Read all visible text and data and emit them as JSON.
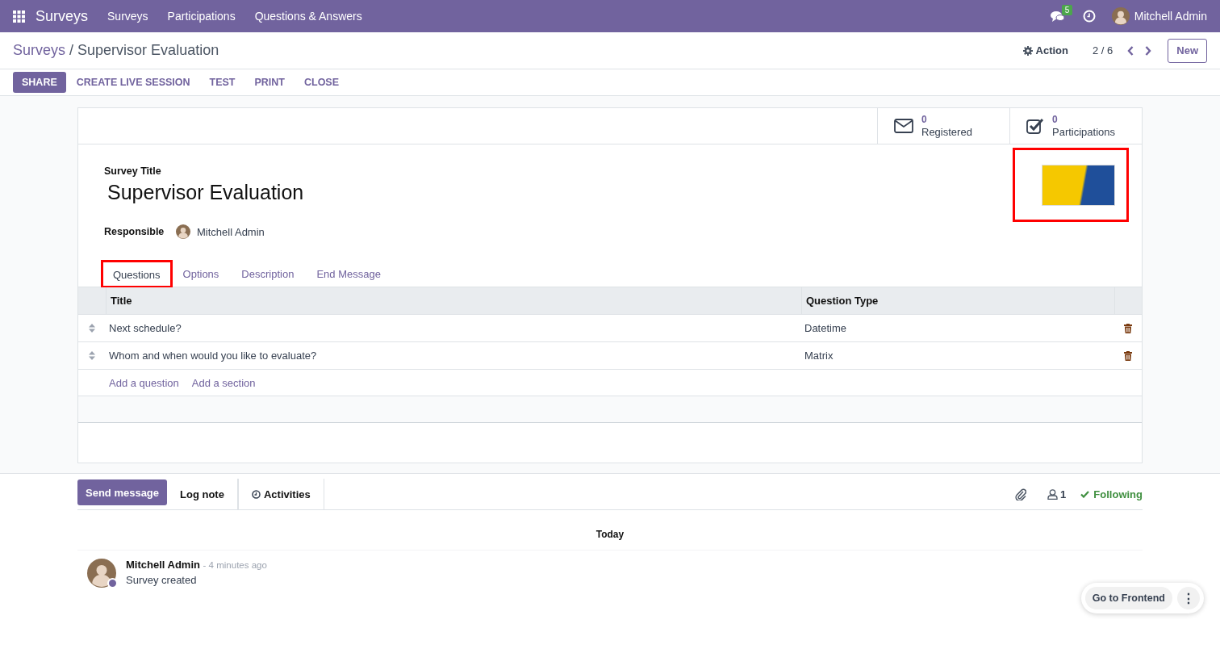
{
  "navbar": {
    "app": "Surveys",
    "menu": [
      "Surveys",
      "Participations",
      "Questions & Answers"
    ],
    "messages_count": "5",
    "user": "Mitchell Admin"
  },
  "breadcrumb": {
    "parent": "Surveys",
    "separator": "/",
    "current": "Supervisor Evaluation"
  },
  "control": {
    "action": "Action",
    "pager": "2 / 6",
    "new_button": "New"
  },
  "buttons": [
    {
      "label": "SHARE",
      "primary": true
    },
    {
      "label": "CREATE LIVE SESSION",
      "primary": false
    },
    {
      "label": "TEST",
      "primary": false
    },
    {
      "label": "PRINT",
      "primary": false
    },
    {
      "label": "CLOSE",
      "primary": false
    }
  ],
  "stat_buttons": [
    {
      "kind": "envelope",
      "value": "0",
      "label": "Registered"
    },
    {
      "kind": "checkbox",
      "value": "0",
      "label": "Participations"
    }
  ],
  "form": {
    "title_label": "Survey Title",
    "title": "Supervisor Evaluation",
    "responsible_label": "Responsible",
    "responsible": "Mitchell Admin",
    "cover_image": {
      "highlighted": true
    }
  },
  "tabs": [
    {
      "label": "Questions",
      "selected": true,
      "highlighted": true
    },
    {
      "label": "Options",
      "selected": false,
      "highlighted": false
    },
    {
      "label": "Description",
      "selected": false,
      "highlighted": false
    },
    {
      "label": "End Message",
      "selected": false,
      "highlighted": false
    }
  ],
  "table": {
    "columns": [
      "Title",
      "Question Type"
    ],
    "rows": [
      {
        "title": "Next schedule?",
        "type": "Datetime"
      },
      {
        "title": "Whom and when would you like to evaluate?",
        "type": "Matrix"
      }
    ],
    "add_links": [
      "Add a question",
      "Add a section"
    ]
  },
  "chatter": {
    "send": "Send message",
    "log": "Log note",
    "activities": "Activities",
    "followers": "1",
    "following": "Following",
    "date": "Today",
    "messages": [
      {
        "author": "Mitchell Admin",
        "time": "- 4 minutes ago",
        "body": "Survey created"
      }
    ]
  },
  "floating": {
    "button": "Go to Frontend",
    "more": "⋮"
  }
}
